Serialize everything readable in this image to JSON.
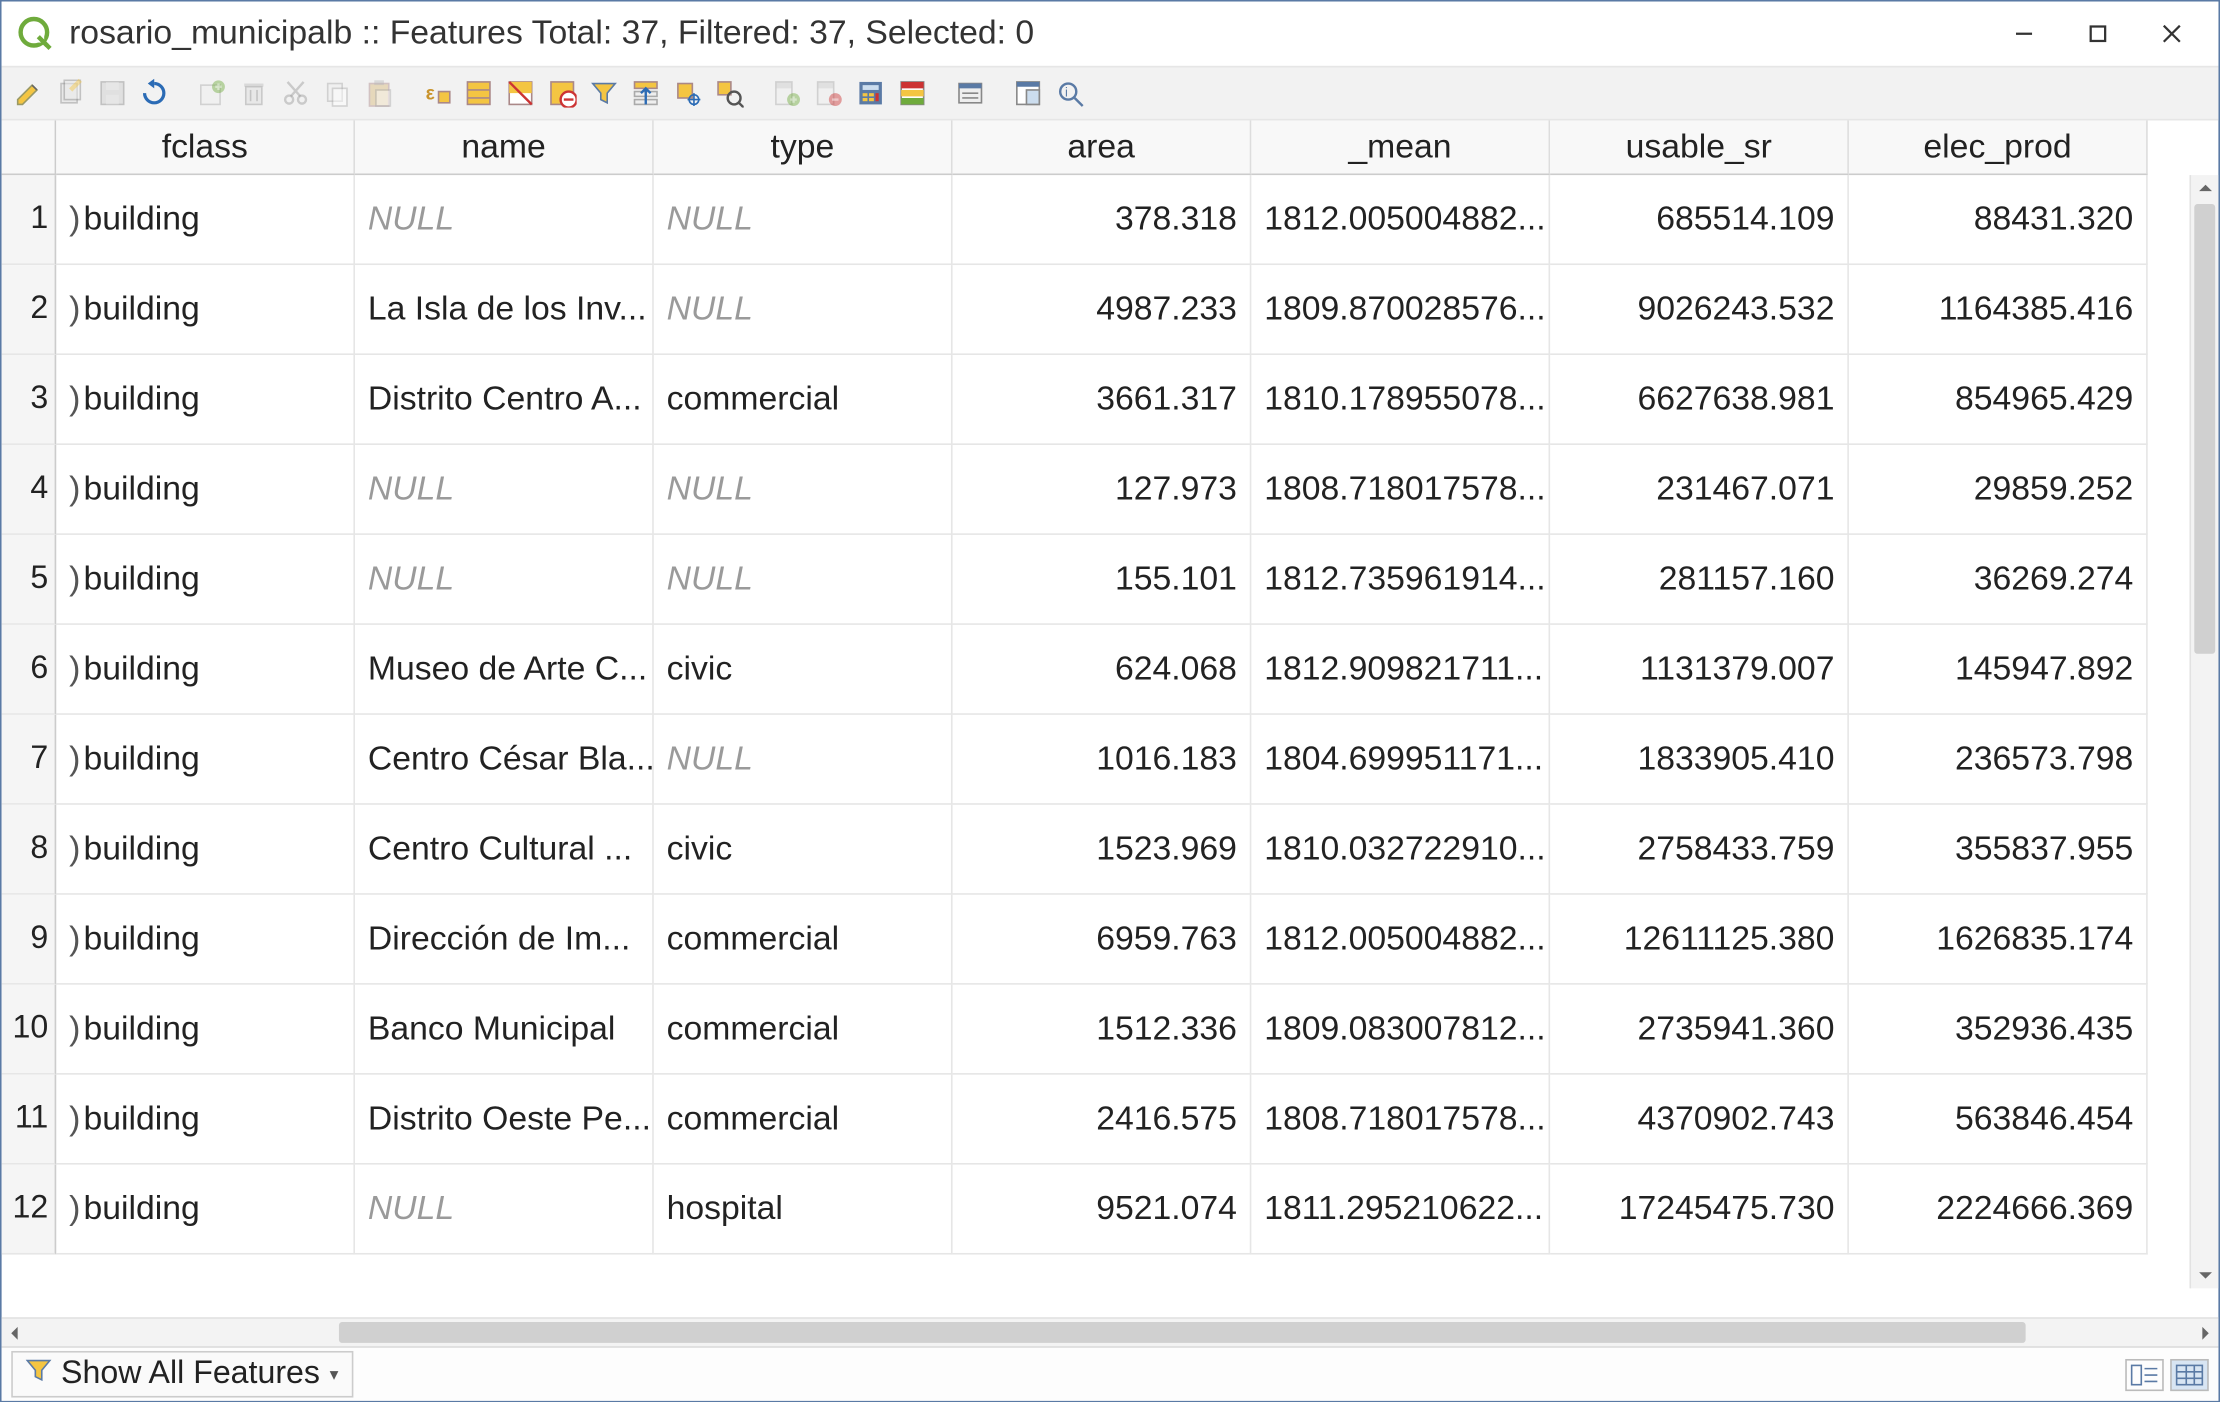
{
  "window": {
    "title": "rosario_municipalb :: Features Total: 37, Filtered: 37, Selected: 0"
  },
  "toolbar_icons": [
    "pencil-icon",
    "multi-edit-icon",
    "save-icon",
    "reload-icon",
    "sep",
    "add-feature-icon",
    "delete-icon",
    "cut-icon",
    "copy-icon",
    "paste-icon",
    "sep",
    "expression-select-icon",
    "select-all-icon",
    "invert-selection-icon",
    "deselect-icon",
    "filter-icon",
    "move-top-icon",
    "pan-to-icon",
    "zoom-to-icon",
    "sep",
    "new-field-icon",
    "delete-field-icon",
    "field-calc-icon",
    "conditional-format-icon",
    "sep",
    "actions-icon",
    "sep",
    "dock-icon",
    "identify-icon"
  ],
  "columns": [
    "fclass",
    "name",
    "type",
    "area",
    "_mean",
    "usable_sr",
    "elec_prod"
  ],
  "column_align": [
    "txt",
    "txt",
    "txt",
    "num",
    "txt",
    "num",
    "num"
  ],
  "null_label": "NULL",
  "fclass_prefix": ")",
  "rows": [
    {
      "n": "1",
      "fclass": "building",
      "name": null,
      "type": null,
      "area": "378.318",
      "_mean": "1812.005004882...",
      "usable_sr": "685514.109",
      "elec_prod": "88431.320"
    },
    {
      "n": "2",
      "fclass": "building",
      "name": "La Isla de los Inv...",
      "type": null,
      "area": "4987.233",
      "_mean": "1809.870028576...",
      "usable_sr": "9026243.532",
      "elec_prod": "1164385.416"
    },
    {
      "n": "3",
      "fclass": "building",
      "name": "Distrito Centro A...",
      "type": "commercial",
      "area": "3661.317",
      "_mean": "1810.178955078...",
      "usable_sr": "6627638.981",
      "elec_prod": "854965.429"
    },
    {
      "n": "4",
      "fclass": "building",
      "name": null,
      "type": null,
      "area": "127.973",
      "_mean": "1808.718017578...",
      "usable_sr": "231467.071",
      "elec_prod": "29859.252"
    },
    {
      "n": "5",
      "fclass": "building",
      "name": null,
      "type": null,
      "area": "155.101",
      "_mean": "1812.735961914...",
      "usable_sr": "281157.160",
      "elec_prod": "36269.274"
    },
    {
      "n": "6",
      "fclass": "building",
      "name": "Museo de Arte C...",
      "type": "civic",
      "area": "624.068",
      "_mean": "1812.909821711...",
      "usable_sr": "1131379.007",
      "elec_prod": "145947.892"
    },
    {
      "n": "7",
      "fclass": "building",
      "name": "Centro César Bla...",
      "type": null,
      "area": "1016.183",
      "_mean": "1804.699951171...",
      "usable_sr": "1833905.410",
      "elec_prod": "236573.798"
    },
    {
      "n": "8",
      "fclass": "building",
      "name": "Centro Cultural ...",
      "type": "civic",
      "area": "1523.969",
      "_mean": "1810.032722910...",
      "usable_sr": "2758433.759",
      "elec_prod": "355837.955"
    },
    {
      "n": "9",
      "fclass": "building",
      "name": "Dirección de Im...",
      "type": "commercial",
      "area": "6959.763",
      "_mean": "1812.005004882...",
      "usable_sr": "12611125.380",
      "elec_prod": "1626835.174"
    },
    {
      "n": "10",
      "fclass": "building",
      "name": "Banco Municipal",
      "type": "commercial",
      "area": "1512.336",
      "_mean": "1809.083007812...",
      "usable_sr": "2735941.360",
      "elec_prod": "352936.435"
    },
    {
      "n": "11",
      "fclass": "building",
      "name": "Distrito Oeste Pe...",
      "type": "commercial",
      "area": "2416.575",
      "_mean": "1808.718017578...",
      "usable_sr": "4370902.743",
      "elec_prod": "563846.454"
    },
    {
      "n": "12",
      "fclass": "building",
      "name": null,
      "type": "hospital",
      "area": "9521.074",
      "_mean": "1811.295210622...",
      "usable_sr": "17245475.730",
      "elec_prod": "2224666.369"
    }
  ],
  "statusbar": {
    "show_all": "Show All Features"
  }
}
